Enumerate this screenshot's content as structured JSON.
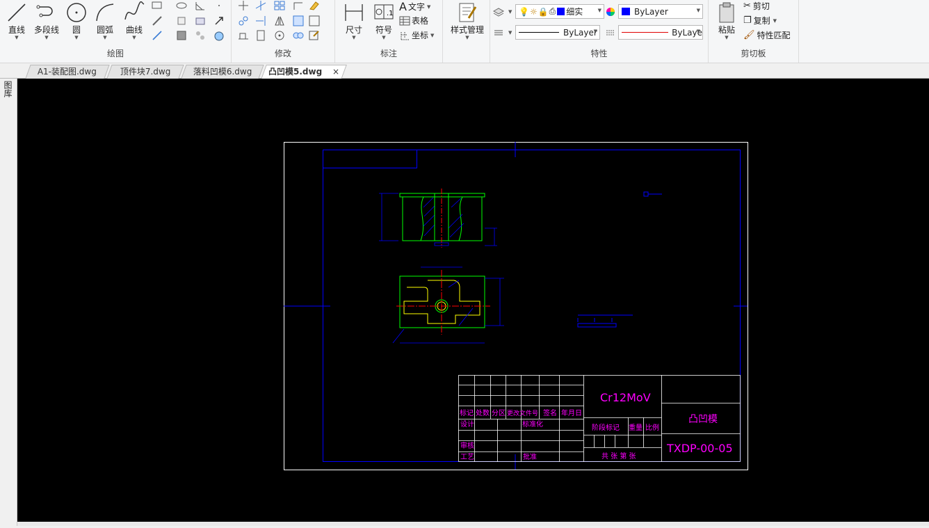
{
  "ribbon": {
    "draw": {
      "label": "绘图",
      "line": "直线",
      "polyline": "多段线",
      "circle": "圆",
      "arc": "圆弧",
      "curve": "曲线"
    },
    "modify": {
      "label": "修改"
    },
    "annotate": {
      "label": "标注",
      "dimension": "尺寸",
      "symbol": "符号",
      "text": "文字",
      "table": "表格",
      "coordinate": "坐标"
    },
    "style": {
      "manage": "样式管理"
    },
    "properties": {
      "label": "特性",
      "layer_name": "细实",
      "color_value": "ByLayer",
      "linetype_value": "ByLayer",
      "lineweight_value": "ByLaye"
    },
    "clipboard": {
      "label": "剪切板",
      "paste": "粘贴",
      "cut": "剪切",
      "copy": "复制",
      "match": "特性匹配"
    }
  },
  "side_panel": {
    "label": "图库"
  },
  "tabs": [
    {
      "label": "A1-装配图.dwg"
    },
    {
      "label": "顶件块7.dwg"
    },
    {
      "label": "落料凹模6.dwg"
    },
    {
      "label": "凸凹模5.dwg",
      "active": true,
      "close": "×"
    }
  ],
  "drawing": {
    "material": "Cr12MoV",
    "part_name": "凸凹模",
    "drawing_no": "TXDP-00-05",
    "title_block": {
      "mark": "标记",
      "count": "处数",
      "zone": "分区",
      "change_doc": "更改文件号",
      "sign": "签名",
      "date": "年月日",
      "design": "设计",
      "standard": "标准化",
      "stage_mark": "阶段标记",
      "weight": "重量",
      "scale": "比例",
      "review": "审核",
      "process": "工艺",
      "approve": "批准",
      "sheets": "共  张  第  张"
    }
  },
  "colors": {
    "canvas_bg": "#000000",
    "frame": "#ffffff",
    "border": "#0000ff",
    "outline": "#00ff00",
    "hatch": "#0000ff",
    "center": "#ff0000",
    "title_text": "#ff00ff",
    "dimension": "#0000ff",
    "hidden": "#ffff00"
  }
}
